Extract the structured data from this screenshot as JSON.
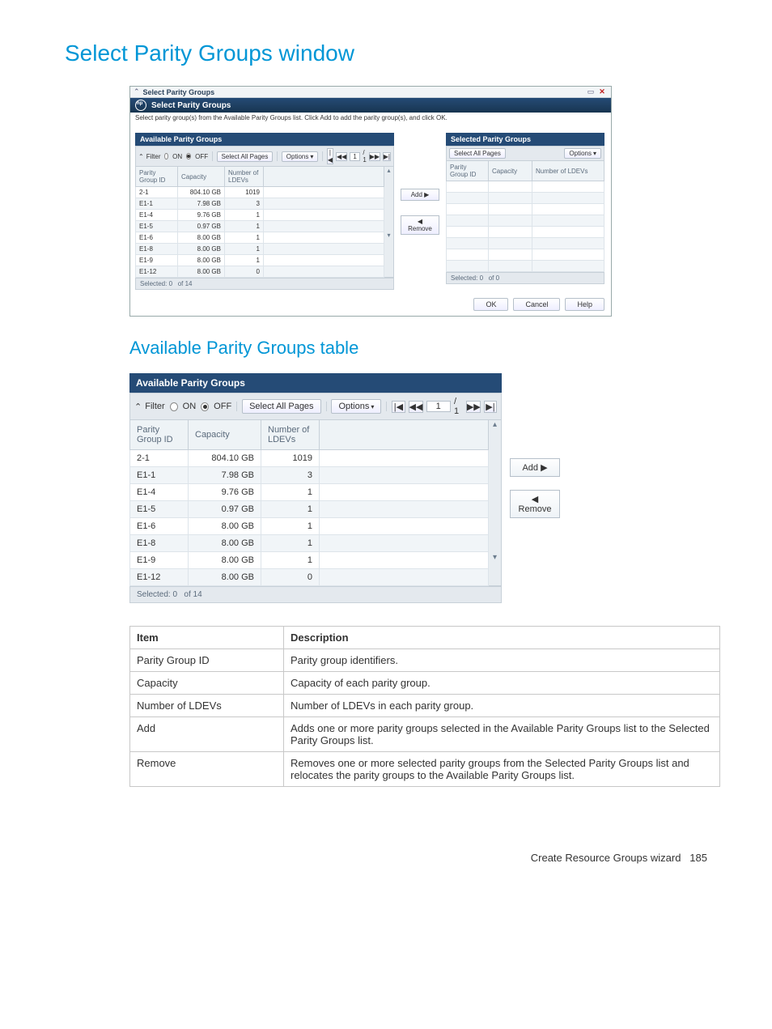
{
  "page": {
    "title": "Select Parity Groups window",
    "subtitle": "Available Parity Groups table",
    "footer_label": "Create Resource Groups wizard",
    "footer_page": "185"
  },
  "window": {
    "titlebar": "Select Parity Groups",
    "header": "Select Parity Groups",
    "instruction": "Select parity group(s) from the Available Parity Groups list. Click Add to add the parity group(s), and click OK.",
    "ok": "OK",
    "cancel": "Cancel",
    "help": "Help"
  },
  "available": {
    "title": "Available Parity Groups",
    "filter_label": "Filter",
    "on_label": "ON",
    "off_label": "OFF",
    "select_all": "Select All Pages",
    "options": "Options",
    "page_current": "1",
    "page_total": "/ 1",
    "columns": [
      "Parity Group ID",
      "Capacity",
      "Number of LDEVs"
    ],
    "rows": [
      {
        "id": "2-1",
        "cap": "804.10 GB",
        "n": "1019"
      },
      {
        "id": "E1-1",
        "cap": "7.98 GB",
        "n": "3"
      },
      {
        "id": "E1-4",
        "cap": "9.76 GB",
        "n": "1"
      },
      {
        "id": "E1-5",
        "cap": "0.97 GB",
        "n": "1"
      },
      {
        "id": "E1-6",
        "cap": "8.00 GB",
        "n": "1"
      },
      {
        "id": "E1-8",
        "cap": "8.00 GB",
        "n": "1"
      },
      {
        "id": "E1-9",
        "cap": "8.00 GB",
        "n": "1"
      },
      {
        "id": "E1-12",
        "cap": "8.00 GB",
        "n": "0"
      }
    ],
    "status_sel": "Selected: 0",
    "status_of": "of 14"
  },
  "selected": {
    "title": "Selected Parity Groups",
    "select_all": "Select All Pages",
    "options": "Options",
    "columns": [
      "Parity Group ID",
      "Capacity",
      "Number of LDEVs"
    ],
    "status_sel": "Selected: 0",
    "status_of": "of 0"
  },
  "transfer": {
    "add": "Add ▶",
    "remove": "◀ Remove"
  },
  "desc": {
    "head_item": "Item",
    "head_desc": "Description",
    "rows": [
      {
        "item": "Parity Group ID",
        "desc": "Parity group identifiers."
      },
      {
        "item": "Capacity",
        "desc": "Capacity of each parity group."
      },
      {
        "item": "Number of LDEVs",
        "desc": "Number of LDEVs in each parity group."
      },
      {
        "item": "Add",
        "desc": "Adds one or more parity groups selected in the Available Parity Groups list to the Selected Parity Groups list."
      },
      {
        "item": "Remove",
        "desc": "Removes one or more selected parity groups from the Selected Parity Groups list and relocates the parity groups to the Available Parity Groups list."
      }
    ]
  }
}
